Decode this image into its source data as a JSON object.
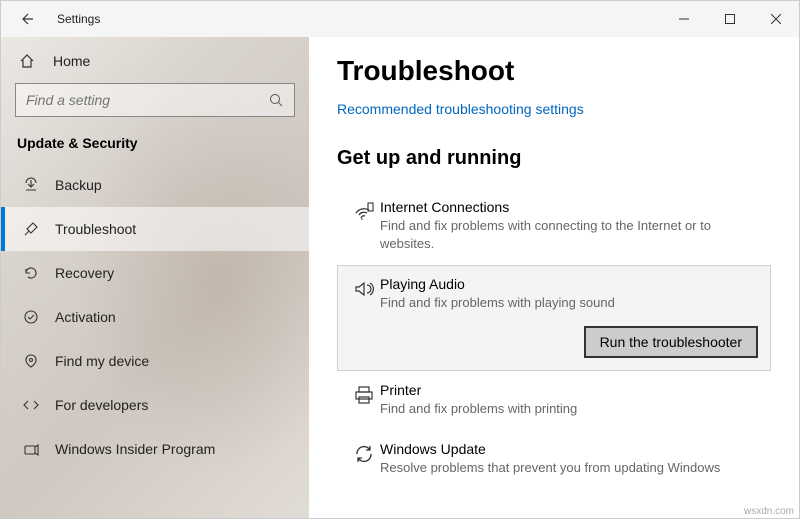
{
  "titlebar": {
    "title": "Settings"
  },
  "sidebar": {
    "home_label": "Home",
    "search_placeholder": "Find a setting",
    "category": "Update & Security",
    "items": [
      {
        "label": "Backup",
        "icon": "backup"
      },
      {
        "label": "Troubleshoot",
        "icon": "troubleshoot",
        "active": true
      },
      {
        "label": "Recovery",
        "icon": "recovery"
      },
      {
        "label": "Activation",
        "icon": "activation"
      },
      {
        "label": "Find my device",
        "icon": "find"
      },
      {
        "label": "For developers",
        "icon": "dev"
      },
      {
        "label": "Windows Insider Program",
        "icon": "insider"
      }
    ]
  },
  "main": {
    "title": "Troubleshoot",
    "link": "Recommended troubleshooting settings",
    "section_title": "Get up and running",
    "items": [
      {
        "title": "Internet Connections",
        "desc": "Find and fix problems with connecting to the Internet or to websites."
      },
      {
        "title": "Playing Audio",
        "desc": "Find and fix problems with playing sound",
        "selected": true,
        "button": "Run the troubleshooter"
      },
      {
        "title": "Printer",
        "desc": "Find and fix problems with printing"
      },
      {
        "title": "Windows Update",
        "desc": "Resolve problems that prevent you from updating Windows"
      }
    ]
  },
  "watermark": "wsxdn.com"
}
